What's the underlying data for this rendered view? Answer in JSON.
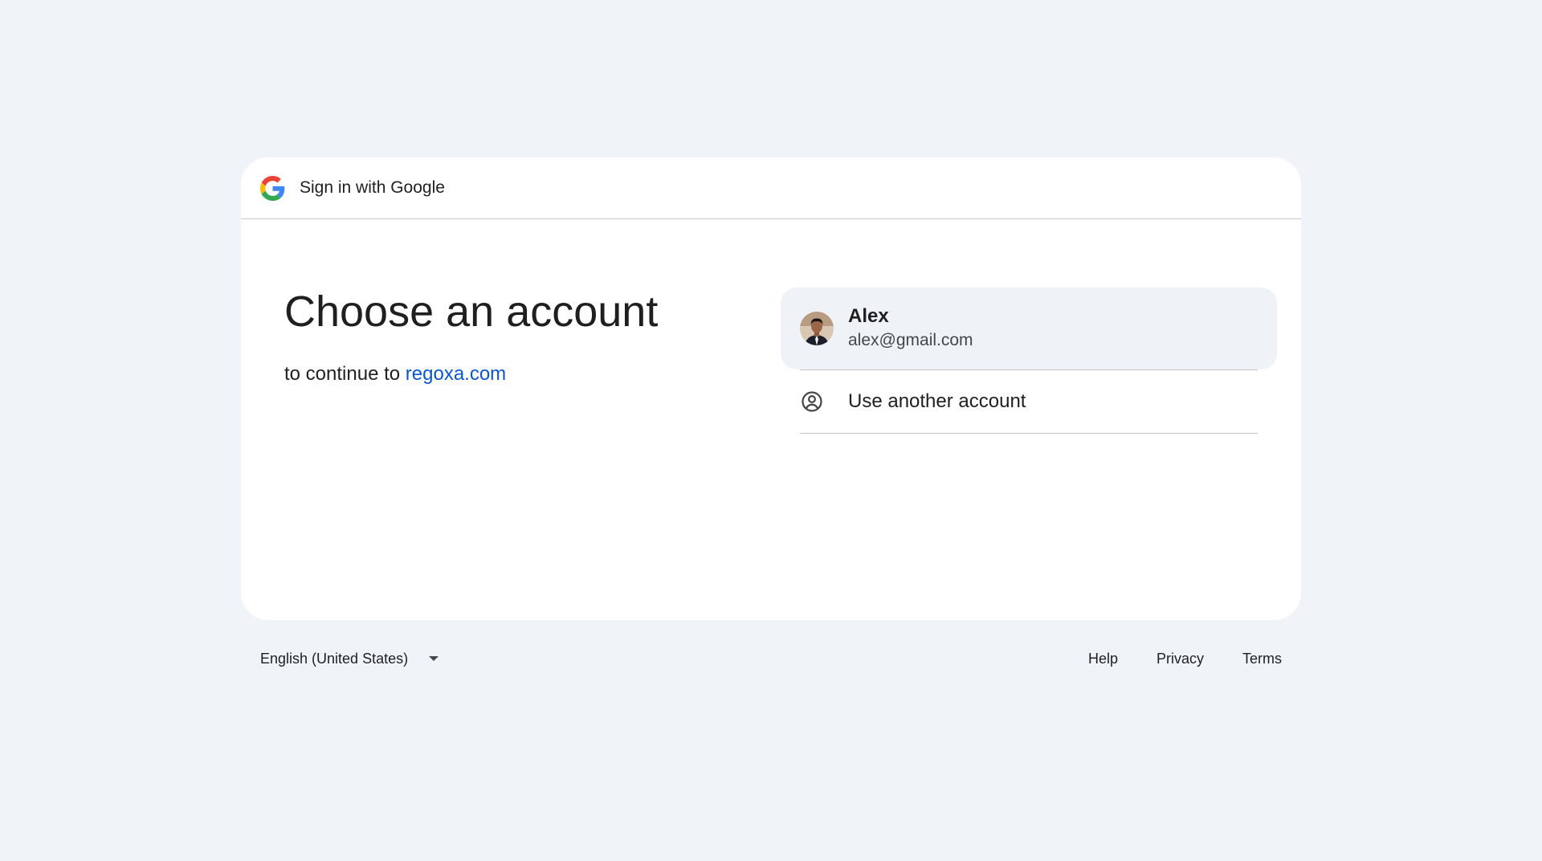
{
  "header": {
    "logo_icon": "google-g-icon",
    "title": "Sign in with Google"
  },
  "main": {
    "title": "Choose an account",
    "subtitle_prefix": "to continue to",
    "site_link": "regoxa.com"
  },
  "accounts": [
    {
      "name": "Alex",
      "email": "alex@gmail.com",
      "avatar_icon": "profile-photo"
    }
  ],
  "other_account": {
    "icon": "account-circle-icon",
    "label": "Use another account"
  },
  "footer": {
    "language": "English (United States)",
    "links": [
      "Help",
      "Privacy",
      "Terms"
    ]
  },
  "colors": {
    "background": "#f0f4f9",
    "card": "#ffffff",
    "link": "#0b57d0",
    "selected_row": "#eff3f8",
    "divider": "#c7c7c7"
  }
}
